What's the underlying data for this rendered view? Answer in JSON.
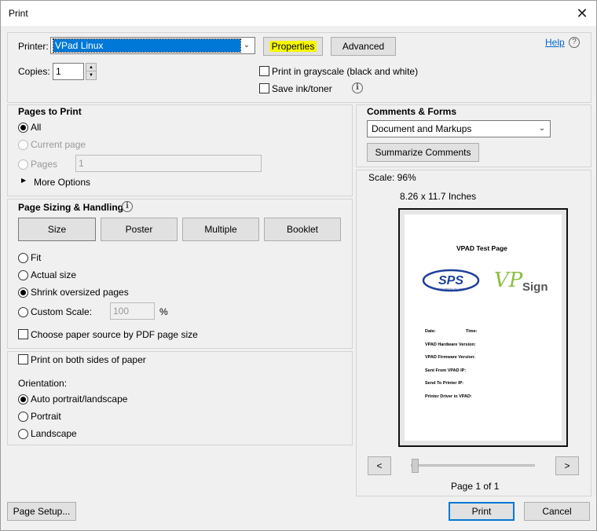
{
  "window": {
    "title": "Print"
  },
  "top": {
    "printer_label": "Printer:",
    "printer_value": "VPad Linux",
    "properties_label": "Properties",
    "advanced_label": "Advanced",
    "help_label": "Help",
    "copies_label": "Copies:",
    "copies_value": "1",
    "grayscale_label": "Print in grayscale (black and white)",
    "save_ink_label": "Save ink/toner"
  },
  "pages_to_print": {
    "heading": "Pages to Print",
    "all_label": "All",
    "current_page_label": "Current page",
    "pages_label": "Pages",
    "pages_value": "1",
    "more_options_label": "More Options"
  },
  "sizing": {
    "heading": "Page Sizing & Handling",
    "tabs": [
      "Size",
      "Poster",
      "Multiple",
      "Booklet"
    ],
    "fit_label": "Fit",
    "actual_label": "Actual size",
    "shrink_label": "Shrink oversized pages",
    "custom_label": "Custom Scale:",
    "custom_value": "100",
    "percent": "%",
    "paper_source_label": "Choose paper source by PDF page size"
  },
  "duplex": {
    "both_sides_label": "Print on both sides of paper",
    "orientation_label": "Orientation:",
    "auto_label": "Auto portrait/landscape",
    "portrait_label": "Portrait",
    "landscape_label": "Landscape"
  },
  "comments": {
    "heading": "Comments & Forms",
    "select_value": "Document and Markups",
    "summarize_label": "Summarize Comments"
  },
  "preview": {
    "scale_text": "Scale:  96%",
    "size_text": "8.26 x 11.7 Inches",
    "page_title": "VPAD Test Page",
    "logo_sps": "SPS",
    "logo_sps_sub": "SMART PRINTING SOLUTIONS",
    "logo_vp_letters": "VP",
    "logo_vp_sign": "Sign",
    "fields": [
      "Date:",
      "Time:",
      "VPAD Hardware Version:",
      "VPAD Firmware Version:",
      "Sent From VPAD IP:",
      "Send To Printer IP:",
      "Printer Driver in VPAD:"
    ],
    "prev_label": "<",
    "next_label": ">",
    "page_indicator": "Page 1 of 1",
    "slider_position": 0
  },
  "bottom": {
    "page_setup_label": "Page Setup...",
    "print_label": "Print",
    "cancel_label": "Cancel"
  },
  "colors": {
    "accent": "#0078d7",
    "highlight": "#f7f700",
    "link": "#0066cc",
    "logo_sps": "#1e3f9a",
    "logo_vpsign_green": "#8cbf3f",
    "logo_vpsign_gray": "#555555"
  }
}
